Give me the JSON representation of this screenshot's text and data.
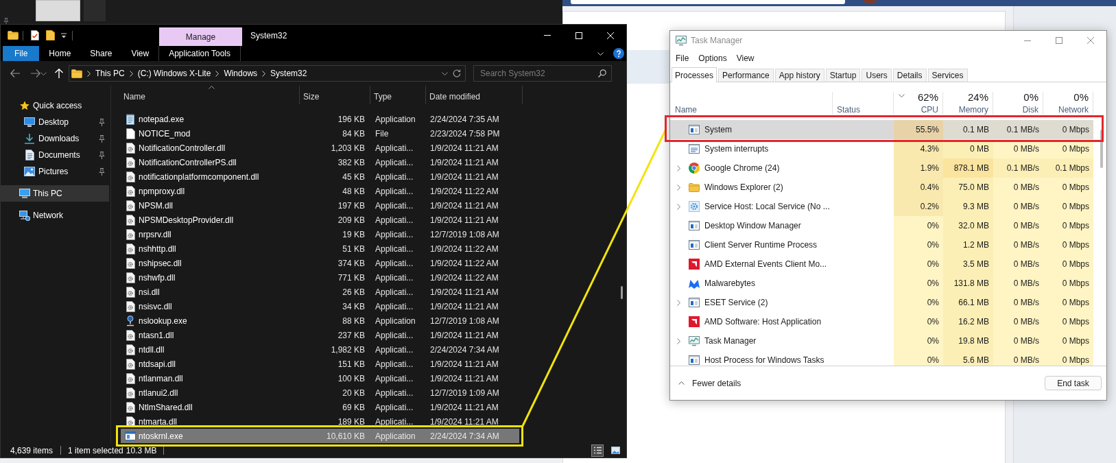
{
  "explorer": {
    "title": "System32",
    "context_label": "Manage",
    "ribbon_tabs": [
      {
        "label": "File",
        "kind": "file"
      },
      {
        "label": "Home",
        "kind": "tab"
      },
      {
        "label": "Share",
        "kind": "tab"
      },
      {
        "label": "View",
        "kind": "tab"
      },
      {
        "label": "Application Tools",
        "kind": "context"
      }
    ],
    "breadcrumbs": [
      "This PC",
      "(C:) Windows X-Lite",
      "Windows",
      "System32"
    ],
    "search": {
      "placeholder": "Search System32"
    },
    "sidebar": [
      {
        "label": "Quick access",
        "selected": false,
        "children": [
          {
            "label": "Desktop",
            "pinned": true,
            "selected": false
          },
          {
            "label": "Downloads",
            "pinned": true,
            "selected": false
          },
          {
            "label": "Documents",
            "pinned": true,
            "selected": false
          },
          {
            "label": "Pictures",
            "pinned": true,
            "selected": false
          }
        ]
      },
      {
        "label": "This PC",
        "selected": true
      },
      {
        "label": "Network",
        "selected": false
      }
    ],
    "columns": [
      {
        "label": "Name",
        "sorted": true
      },
      {
        "label": "Size",
        "sorted": false
      },
      {
        "label": "Type",
        "sorted": false
      },
      {
        "label": "Date modified",
        "sorted": false
      }
    ],
    "files": [
      {
        "name": "notepad.exe",
        "size": "196 KB",
        "type": "Application",
        "date": "2/24/2024 7:35 AM",
        "selected": false
      },
      {
        "name": "NOTICE_mod",
        "size": "84 KB",
        "type": "File",
        "date": "2/23/2024 7:58 PM",
        "selected": false
      },
      {
        "name": "NotificationController.dll",
        "size": "1,203 KB",
        "type": "Applicati...",
        "date": "1/9/2024 11:21 AM",
        "selected": false
      },
      {
        "name": "NotificationControllerPS.dll",
        "size": "382 KB",
        "type": "Applicati...",
        "date": "1/9/2024 11:21 AM",
        "selected": false
      },
      {
        "name": "notificationplatformcomponent.dll",
        "size": "45 KB",
        "type": "Applicati...",
        "date": "1/9/2024 11:21 AM",
        "selected": false
      },
      {
        "name": "npmproxy.dll",
        "size": "48 KB",
        "type": "Applicati...",
        "date": "1/9/2024 11:22 AM",
        "selected": false
      },
      {
        "name": "NPSM.dll",
        "size": "197 KB",
        "type": "Applicati...",
        "date": "1/9/2024 11:21 AM",
        "selected": false
      },
      {
        "name": "NPSMDesktopProvider.dll",
        "size": "209 KB",
        "type": "Applicati...",
        "date": "1/9/2024 11:21 AM",
        "selected": false
      },
      {
        "name": "nrpsrv.dll",
        "size": "19 KB",
        "type": "Applicati...",
        "date": "12/7/2019 1:08 AM",
        "selected": false
      },
      {
        "name": "nshhttp.dll",
        "size": "51 KB",
        "type": "Applicati...",
        "date": "1/9/2024 11:22 AM",
        "selected": false
      },
      {
        "name": "nshipsec.dll",
        "size": "374 KB",
        "type": "Applicati...",
        "date": "1/9/2024 11:22 AM",
        "selected": false
      },
      {
        "name": "nshwfp.dll",
        "size": "771 KB",
        "type": "Applicati...",
        "date": "1/9/2024 11:22 AM",
        "selected": false
      },
      {
        "name": "nsi.dll",
        "size": "26 KB",
        "type": "Applicati...",
        "date": "1/9/2024 11:21 AM",
        "selected": false
      },
      {
        "name": "nsisvc.dll",
        "size": "34 KB",
        "type": "Applicati...",
        "date": "1/9/2024 11:21 AM",
        "selected": false
      },
      {
        "name": "nslookup.exe",
        "size": "88 KB",
        "type": "Application",
        "date": "12/7/2019 1:08 AM",
        "selected": false
      },
      {
        "name": "ntasn1.dll",
        "size": "237 KB",
        "type": "Applicati...",
        "date": "1/9/2024 11:21 AM",
        "selected": false
      },
      {
        "name": "ntdll.dll",
        "size": "1,982 KB",
        "type": "Applicati...",
        "date": "2/24/2024 7:34 AM",
        "selected": false
      },
      {
        "name": "ntdsapi.dll",
        "size": "151 KB",
        "type": "Applicati...",
        "date": "1/9/2024 11:21 AM",
        "selected": false
      },
      {
        "name": "ntlanman.dll",
        "size": "100 KB",
        "type": "Applicati...",
        "date": "1/9/2024 11:21 AM",
        "selected": false
      },
      {
        "name": "ntlanui2.dll",
        "size": "20 KB",
        "type": "Applicati...",
        "date": "12/7/2019 1:09 AM",
        "selected": false
      },
      {
        "name": "NtlmShared.dll",
        "size": "69 KB",
        "type": "Applicati...",
        "date": "1/9/2024 11:21 AM",
        "selected": false
      },
      {
        "name": "ntmarta.dll",
        "size": "189 KB",
        "type": "Applicati...",
        "date": "1/9/2024 11:21 AM",
        "selected": false
      },
      {
        "name": "ntoskrnl.exe",
        "size": "10,610 KB",
        "type": "Application",
        "date": "2/24/2024 7:34 AM",
        "selected": true
      }
    ],
    "status_bar": {
      "item_count": "4,639 items",
      "selection": "1 item selected",
      "selection_size": "10.3 MB"
    },
    "view_modes": [
      {
        "selected": true
      },
      {
        "selected": false
      }
    ]
  },
  "task_manager": {
    "title": "Task Manager",
    "menu": [
      "File",
      "Options",
      "View"
    ],
    "tabs": [
      {
        "label": "Processes",
        "selected": true
      },
      {
        "label": "Performance",
        "selected": false
      },
      {
        "label": "App history",
        "selected": false
      },
      {
        "label": "Startup",
        "selected": false
      },
      {
        "label": "Users",
        "selected": false
      },
      {
        "label": "Details",
        "selected": false
      },
      {
        "label": "Services",
        "selected": false
      }
    ],
    "columns": [
      {
        "label": "Name",
        "sorted": false
      },
      {
        "label": "Status",
        "sorted": false
      },
      {
        "label": "CPU",
        "usage": "62%",
        "sorted": true
      },
      {
        "label": "Memory",
        "usage": "24%",
        "sorted": false
      },
      {
        "label": "Disk",
        "usage": "0%",
        "sorted": false
      },
      {
        "label": "Network",
        "usage": "0%",
        "sorted": false
      }
    ],
    "processes": [
      {
        "name": "System",
        "kind": "process",
        "selected": true,
        "cells": [
          {
            "text": "55.5%",
            "color": "#e8d3a9"
          },
          {
            "text": "0.1 MB",
            "color": "#dedbd1"
          },
          {
            "text": "0.1 MB/s",
            "color": "#dedbd1"
          },
          {
            "text": "0 Mbps",
            "color": "#dedbd1"
          }
        ]
      },
      {
        "name": "System interrupts",
        "kind": "process",
        "selected": false,
        "cells": [
          {
            "text": "4.3%",
            "color": "#f9e9ae"
          },
          {
            "text": "0 MB",
            "color": "#fcefb6"
          },
          {
            "text": "0 MB/s",
            "color": "#fff4c4"
          },
          {
            "text": "0 Mbps",
            "color": "#fff4c4"
          }
        ]
      },
      {
        "name": "Google Chrome (24)",
        "kind": "group",
        "selected": false,
        "cells": [
          {
            "text": "1.9%",
            "color": "#f9e9ae"
          },
          {
            "text": "878.1 MB",
            "color": "#fae49e"
          },
          {
            "text": "0.1 MB/s",
            "color": "#fcefb6"
          },
          {
            "text": "0.1 Mbps",
            "color": "#fcefb6"
          }
        ]
      },
      {
        "name": "Windows Explorer (2)",
        "kind": "group",
        "selected": false,
        "cells": [
          {
            "text": "0.4%",
            "color": "#f9e9ae"
          },
          {
            "text": "75.0 MB",
            "color": "#fcefb6"
          },
          {
            "text": "0 MB/s",
            "color": "#fff4c4"
          },
          {
            "text": "0 Mbps",
            "color": "#fff4c4"
          }
        ]
      },
      {
        "name": "Service Host: Local Service (No ...",
        "kind": "group",
        "selected": false,
        "cells": [
          {
            "text": "0.2%",
            "color": "#f9e9ae"
          },
          {
            "text": "9.3 MB",
            "color": "#fcefb6"
          },
          {
            "text": "0 MB/s",
            "color": "#fff4c4"
          },
          {
            "text": "0 Mbps",
            "color": "#fff4c4"
          }
        ]
      },
      {
        "name": "Desktop Window Manager",
        "kind": "process",
        "selected": false,
        "cells": [
          {
            "text": "0%",
            "color": "#fff4c4"
          },
          {
            "text": "32.0 MB",
            "color": "#fcefb6"
          },
          {
            "text": "0 MB/s",
            "color": "#fff4c4"
          },
          {
            "text": "0 Mbps",
            "color": "#fff4c4"
          }
        ]
      },
      {
        "name": "Client Server Runtime Process",
        "kind": "process",
        "selected": false,
        "cells": [
          {
            "text": "0%",
            "color": "#fff4c4"
          },
          {
            "text": "1.2 MB",
            "color": "#fcefb6"
          },
          {
            "text": "0 MB/s",
            "color": "#fff4c4"
          },
          {
            "text": "0 Mbps",
            "color": "#fff4c4"
          }
        ]
      },
      {
        "name": "AMD External Events Client Mo...",
        "kind": "process",
        "selected": false,
        "cells": [
          {
            "text": "0%",
            "color": "#fff4c4"
          },
          {
            "text": "3.5 MB",
            "color": "#fcefb6"
          },
          {
            "text": "0 MB/s",
            "color": "#fff4c4"
          },
          {
            "text": "0 Mbps",
            "color": "#fff4c4"
          }
        ]
      },
      {
        "name": "Malwarebytes",
        "kind": "process",
        "selected": false,
        "cells": [
          {
            "text": "0%",
            "color": "#fff4c4"
          },
          {
            "text": "131.8 MB",
            "color": "#fcefb6"
          },
          {
            "text": "0 MB/s",
            "color": "#fff4c4"
          },
          {
            "text": "0 Mbps",
            "color": "#fff4c4"
          }
        ]
      },
      {
        "name": "ESET Service (2)",
        "kind": "group",
        "selected": false,
        "cells": [
          {
            "text": "0%",
            "color": "#fff4c4"
          },
          {
            "text": "66.1 MB",
            "color": "#fcefb6"
          },
          {
            "text": "0 MB/s",
            "color": "#fff4c4"
          },
          {
            "text": "0 Mbps",
            "color": "#fff4c4"
          }
        ]
      },
      {
        "name": "AMD Software: Host Application",
        "kind": "process",
        "selected": false,
        "cells": [
          {
            "text": "0%",
            "color": "#fff4c4"
          },
          {
            "text": "16.2 MB",
            "color": "#fcefb6"
          },
          {
            "text": "0 MB/s",
            "color": "#fff4c4"
          },
          {
            "text": "0 Mbps",
            "color": "#fff4c4"
          }
        ]
      },
      {
        "name": "Task Manager",
        "kind": "group",
        "selected": false,
        "cells": [
          {
            "text": "0%",
            "color": "#fff4c4"
          },
          {
            "text": "19.8 MB",
            "color": "#fcefb6"
          },
          {
            "text": "0 MB/s",
            "color": "#fff4c4"
          },
          {
            "text": "0 Mbps",
            "color": "#fff4c4"
          }
        ]
      },
      {
        "name": "Host Process for Windows Tasks",
        "kind": "process",
        "selected": false,
        "cells": [
          {
            "text": "0%",
            "color": "#fff4c4"
          },
          {
            "text": "5.6 MB",
            "color": "#fcefb6"
          },
          {
            "text": "0 MB/s",
            "color": "#fff4c4"
          },
          {
            "text": "0 Mbps",
            "color": "#fff4c4"
          }
        ]
      }
    ],
    "footer": {
      "toggle": "Fewer details",
      "action": "End task"
    }
  }
}
